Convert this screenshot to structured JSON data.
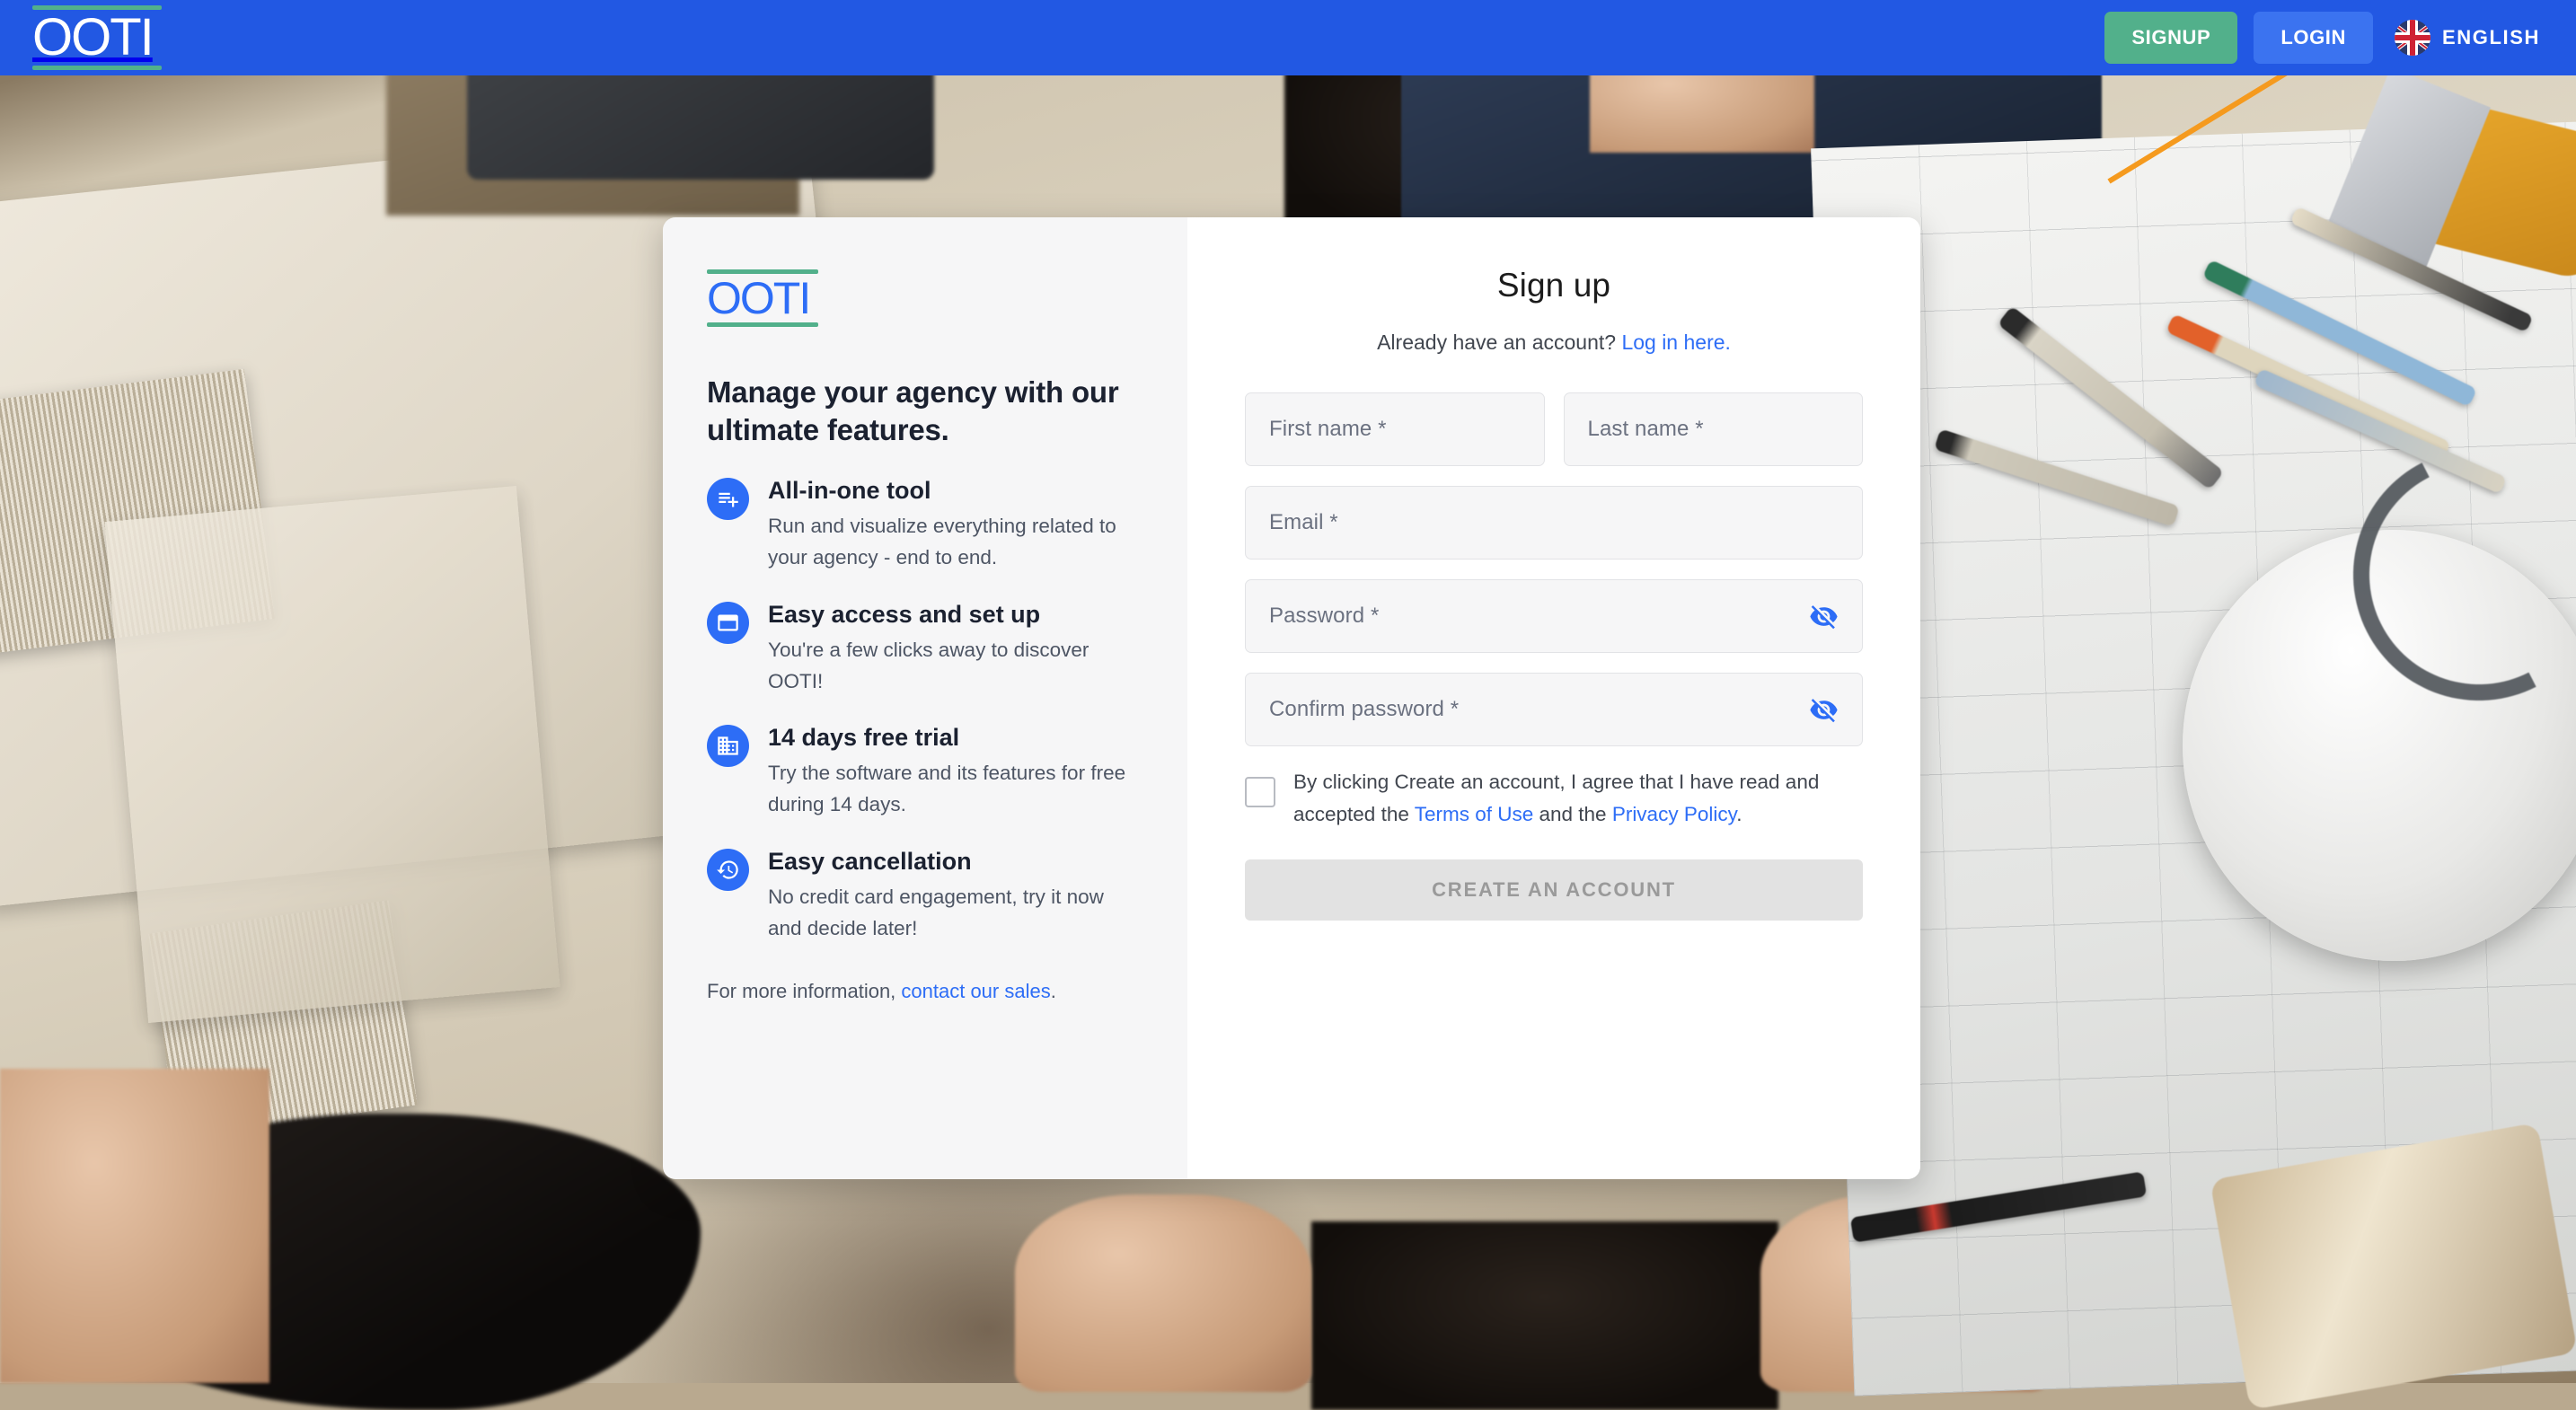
{
  "topbar": {
    "logo_text": "OOTI",
    "signup_label": "SIGNUP",
    "login_label": "LOGIN",
    "language_label": "ENGLISH",
    "language_flag": "uk-flag-icon",
    "bar_color": "#2258e3",
    "signup_color": "#52b08b",
    "login_color": "#3b73f0",
    "annotation_arrow_color": "#f59a1e"
  },
  "marketing": {
    "logo_text": "OOTI",
    "logo_color": "#2d6df6",
    "logo_rule_color": "#52b08b",
    "heading": "Manage your agency with our ultimate features.",
    "features": [
      {
        "icon": "playlist-add-icon",
        "title": "All-in-one tool",
        "desc": "Run and visualize everything related to your agency - end to end."
      },
      {
        "icon": "web-window-icon",
        "title": "Easy access and set up",
        "desc": "You're a few clicks away to discover OOTI!"
      },
      {
        "icon": "business-building-icon",
        "title": "14 days free trial",
        "desc": "Try the software and its features for free during 14 days."
      },
      {
        "icon": "history-clock-icon",
        "title": "Easy cancellation",
        "desc": "No credit card engagement, try it now and decide later!"
      }
    ],
    "footer_prefix": "For more information, ",
    "footer_link": "contact our sales",
    "footer_suffix": "."
  },
  "form": {
    "title": "Sign up",
    "subtitle_prefix": "Already have an account? ",
    "subtitle_link": "Log in here.",
    "fields": {
      "first_name": {
        "placeholder": "First name *",
        "value": ""
      },
      "last_name": {
        "placeholder": "Last name *",
        "value": ""
      },
      "email": {
        "placeholder": "Email *",
        "value": ""
      },
      "password": {
        "placeholder": "Password *",
        "value": "",
        "toggle_icon": "eye-off-icon"
      },
      "confirm_password": {
        "placeholder": "Confirm password *",
        "value": "",
        "toggle_icon": "eye-off-icon"
      }
    },
    "terms": {
      "checked": false,
      "text_part1": "By clicking Create an account, I agree that I have read and accepted the ",
      "link1": "Terms of Use",
      "text_part2": " and the ",
      "link2": "Privacy Policy",
      "text_part3": "."
    },
    "submit_label": "CREATE AN ACCOUNT",
    "submit_enabled": false,
    "link_color": "#2d6df6"
  }
}
